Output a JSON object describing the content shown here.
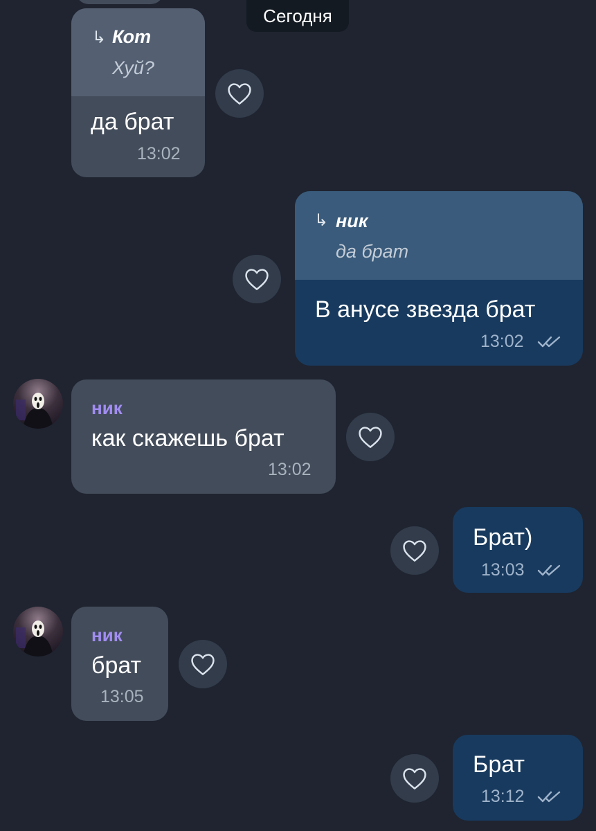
{
  "date_divider": "Сегодня",
  "colors": {
    "background": "#1f2430",
    "incoming_bubble": "#434c5a",
    "outgoing_bubble": "#183a5e",
    "sender_name": "#a28df2"
  },
  "icons": {
    "reply": "reply-arrow-icon",
    "like": "heart-outline-icon",
    "read": "double-check-icon"
  },
  "messages": [
    {
      "direction": "incoming",
      "reply_to": {
        "author": "Кот",
        "text": "Хуй?"
      },
      "text": "да брат",
      "time": "13:02"
    },
    {
      "direction": "outgoing",
      "reply_to": {
        "author": "ник",
        "text": "да брат"
      },
      "text": "В анусе звезда брат",
      "time": "13:02"
    },
    {
      "direction": "incoming",
      "sender": "ник",
      "text": "как скажешь брат",
      "time": "13:02"
    },
    {
      "direction": "outgoing",
      "text": "Брат)",
      "time": "13:03"
    },
    {
      "direction": "incoming",
      "sender": "ник",
      "text": "брат",
      "time": "13:05"
    },
    {
      "direction": "outgoing",
      "text": "Брат",
      "time": "13:12"
    }
  ]
}
